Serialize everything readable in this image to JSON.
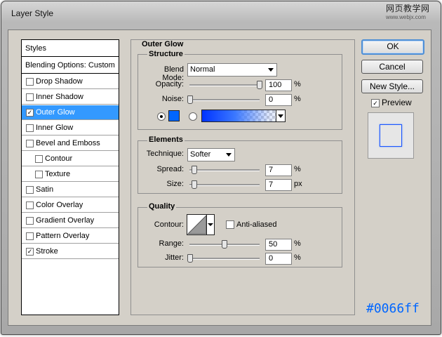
{
  "window": {
    "title": "Layer Style",
    "close_label": "",
    "watermark": "网页教学网",
    "watermark_sub": "www.webjx.com"
  },
  "styles_list": {
    "header": "Styles",
    "blending": "Blending Options: Custom",
    "items": [
      {
        "label": "Drop Shadow",
        "checked": false,
        "check": ""
      },
      {
        "label": "Inner Shadow",
        "checked": false,
        "check": ""
      },
      {
        "label": "Outer Glow",
        "checked": true,
        "check": "✓",
        "selected": true
      },
      {
        "label": "Inner Glow",
        "checked": false,
        "check": ""
      },
      {
        "label": "Bevel and Emboss",
        "checked": false,
        "check": ""
      },
      {
        "label": "Contour",
        "checked": false,
        "check": "",
        "indent": true
      },
      {
        "label": "Texture",
        "checked": false,
        "check": "",
        "indent": true
      },
      {
        "label": "Satin",
        "checked": false,
        "check": ""
      },
      {
        "label": "Color Overlay",
        "checked": false,
        "check": ""
      },
      {
        "label": "Gradient Overlay",
        "checked": false,
        "check": ""
      },
      {
        "label": "Pattern Overlay",
        "checked": false,
        "check": ""
      },
      {
        "label": "Stroke",
        "checked": true,
        "check": "✓"
      }
    ]
  },
  "panel": {
    "title": "Outer Glow",
    "structure": {
      "title": "Structure",
      "blend_mode_label": "Blend Mode:",
      "blend_mode": "Normal",
      "opacity_label": "Opacity:",
      "opacity": "100",
      "noise_label": "Noise:",
      "noise": "0",
      "percent": "%",
      "glow_color": "#0066ff"
    },
    "elements": {
      "title": "Elements",
      "technique_label": "Technique:",
      "technique": "Softer",
      "spread_label": "Spread:",
      "spread": "7",
      "size_label": "Size:",
      "size": "7",
      "percent": "%",
      "px": "px"
    },
    "quality": {
      "title": "Quality",
      "contour_label": "Contour:",
      "antialiased_label": "Anti-aliased",
      "range_label": "Range:",
      "range": "50",
      "jitter_label": "Jitter:",
      "jitter": "0",
      "percent": "%"
    }
  },
  "buttons": {
    "ok": "OK",
    "cancel": "Cancel",
    "new_style": "New Style...",
    "preview": "Preview",
    "preview_check": "✓"
  },
  "hex_color": "#0066ff"
}
